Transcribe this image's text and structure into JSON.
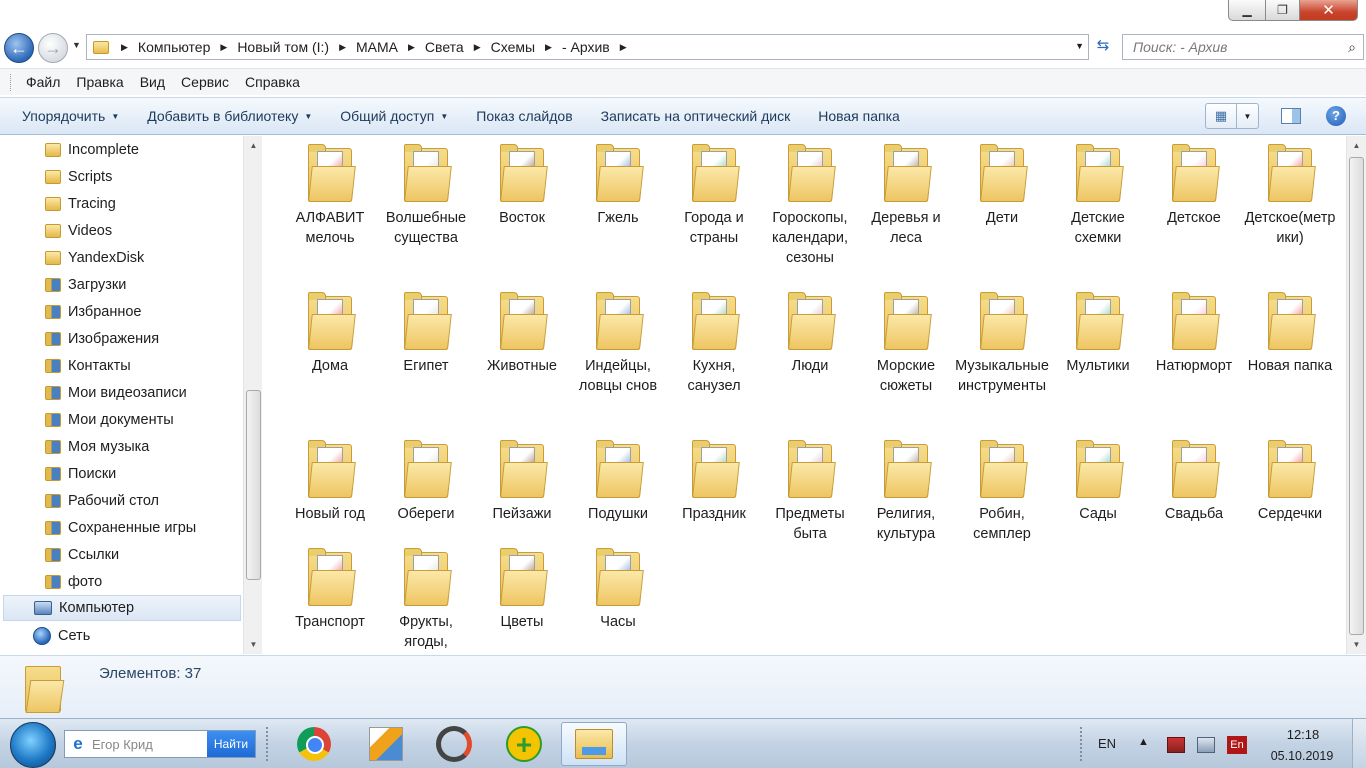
{
  "window": {
    "min_label": "▁",
    "max_label": "❐",
    "close_label": "✕"
  },
  "address": {
    "crumbs": [
      "Компьютер",
      "Новый том (I:)",
      "МАМА",
      "Света",
      "Схемы",
      "- Архив"
    ],
    "search_placeholder": "Поиск: - Архив"
  },
  "menu": [
    "Файл",
    "Правка",
    "Вид",
    "Сервис",
    "Справка"
  ],
  "commands": {
    "organize": "Упорядочить",
    "add_library": "Добавить в библиотеку",
    "share": "Общий доступ",
    "slideshow": "Показ слайдов",
    "burn": "Записать на оптический диск",
    "new_folder": "Новая папка"
  },
  "nav": {
    "items": [
      "Incomplete",
      "Scripts",
      "Tracing",
      "Videos",
      "YandexDisk",
      "Загрузки",
      "Избранное",
      "Изображения",
      "Контакты",
      "Мои видеозаписи",
      "Мои документы",
      "Моя музыка",
      "Поиски",
      "Рабочий стол",
      "Сохраненные игры",
      "Ссылки",
      "фото"
    ],
    "computer": "Компьютер",
    "network": "Сеть"
  },
  "folders": [
    "АЛФАВИТ мелочь",
    "Волшебные существа",
    "Восток",
    "Гжель",
    "Города и страны",
    "Гороскопы, календари, сезоны",
    "Деревья и леса",
    "Дети",
    "Детские схемки",
    "Детское",
    "Детское(метрики)",
    "Дома",
    "Египет",
    "Животные",
    "Индейцы, ловцы снов",
    "Кухня, санузел",
    "Люди",
    "Морские сюжеты",
    "Музыкальные инструменты",
    "Мультики",
    "Натюрморт",
    "Новая папка",
    "Новый год",
    "Обереги",
    "Пейзажи",
    "Подушки",
    "Праздник",
    "Предметы быта",
    "Религия, культура",
    "Робин, семплер",
    "Сады",
    "Свадьба",
    "Сердечки",
    "Транспорт",
    "Фрукты, ягоды,",
    "Цветы",
    "Часы"
  ],
  "details": {
    "count_text": "Элементов: 37"
  },
  "taskbar": {
    "search_placeholder": "Егор Крид",
    "search_button": "Найти",
    "lang": "EN",
    "lang_badge": "En",
    "time": "12:18",
    "date": "05.10.2019"
  }
}
